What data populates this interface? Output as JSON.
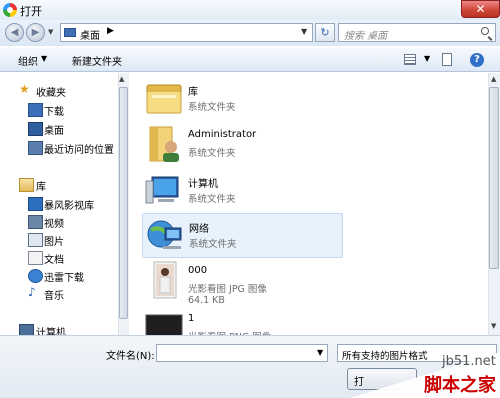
{
  "window": {
    "title": "打开",
    "close_label": "✕"
  },
  "nav": {
    "back_glyph": "◀",
    "forward_glyph": "▶",
    "address": {
      "location": "桌面",
      "chevron": "▶",
      "dropdown": "▼"
    },
    "refresh_glyph": "↻",
    "search_placeholder": "搜索 桌面"
  },
  "toolbar": {
    "organize_label": "组织",
    "organize_caret": "▼",
    "new_folder_label": "新建文件夹",
    "view_caret": "▼",
    "help_label": "?"
  },
  "sidebar": {
    "scroll_up": "▲",
    "items": [
      {
        "label": "收藏夹",
        "icon": "star-icon"
      },
      {
        "label": "下载",
        "icon": "download-folder-icon"
      },
      {
        "label": "桌面",
        "icon": "desktop-icon"
      },
      {
        "label": "最近访问的位置",
        "icon": "recent-places-icon"
      },
      {
        "label": "库",
        "icon": "library-icon"
      },
      {
        "label": "暴风影视库",
        "icon": "video-library-icon"
      },
      {
        "label": "视频",
        "icon": "video-icon"
      },
      {
        "label": "图片",
        "icon": "pictures-icon"
      },
      {
        "label": "文档",
        "icon": "documents-icon"
      },
      {
        "label": "迅雷下载",
        "icon": "thunder-download-icon"
      },
      {
        "label": "音乐",
        "icon": "music-icon"
      },
      {
        "label": "计算机",
        "icon": "computer-icon"
      }
    ]
  },
  "content": {
    "scroll_up": "▲",
    "scroll_down": "▼",
    "items": [
      {
        "name": "库",
        "type": "系统文件夹",
        "icon": "library-folder-icon"
      },
      {
        "name": "Administrator",
        "type": "系统文件夹",
        "icon": "user-folder-icon"
      },
      {
        "name": "计算机",
        "type": "系统文件夹",
        "icon": "computer-icon"
      },
      {
        "name": "网络",
        "type": "系统文件夹",
        "icon": "network-icon",
        "selected": true
      },
      {
        "name": "000",
        "type": "光影看图 JPG 图像",
        "size": "64.1 KB",
        "icon": "photo-thumbnail-icon"
      },
      {
        "name": "1",
        "type": "光影看图 PNG 图像",
        "icon": "dark-image-thumbnail-icon"
      }
    ]
  },
  "bottom": {
    "filename_label": "文件名(N):",
    "filename_value": "",
    "filename_caret": "▼",
    "filetype_value": "所有支持的图片格式",
    "open_label": "打"
  },
  "watermark": {
    "site": "jb51.net",
    "name": "脚本之家"
  },
  "colors": {
    "accent": "#2f71c9",
    "selection_bg": "#e8f2fd",
    "close_red": "#c43",
    "watermark_red": "#cc0000"
  }
}
